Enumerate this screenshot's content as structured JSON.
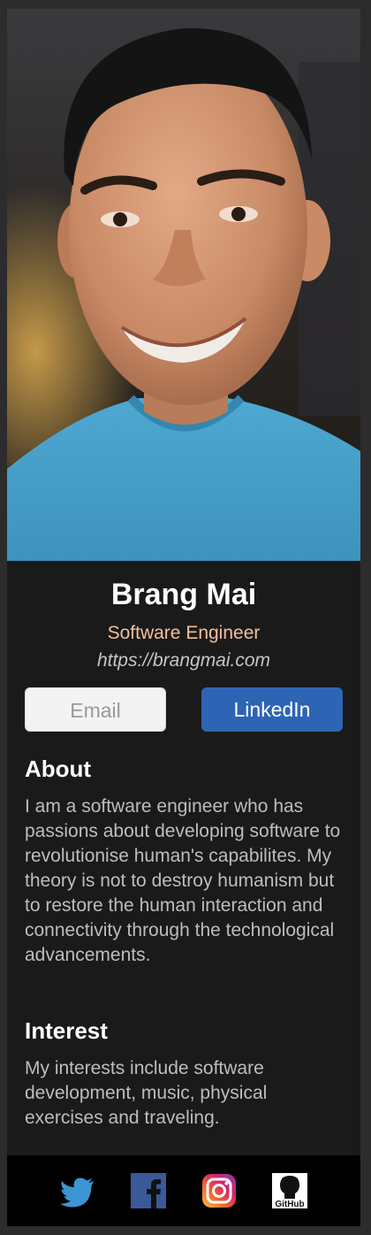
{
  "profile": {
    "name": "Brang Mai",
    "title": "Software Engineer",
    "website": "https://brangmai.com"
  },
  "buttons": {
    "email_label": "Email",
    "linkedin_label": "LinkedIn"
  },
  "about": {
    "heading": "About",
    "text": "I am a software engineer who has passions about developing software to revolutionise human's capabilites. My theory is not to destroy humanism but to restore the human interaction and connectivity through the technological advancements."
  },
  "interest": {
    "heading": "Interest",
    "text": "My interests include software development, music, physical exercises and traveling."
  },
  "footer": {
    "icons": [
      "twitter-icon",
      "facebook-icon",
      "instagram-icon",
      "github-icon"
    ],
    "github_text": "GitHub"
  },
  "colors": {
    "card_background": "#1a1a1b",
    "page_background": "#2c2c2c",
    "title_accent": "#f3bf99",
    "linkedin_blue": "#2e64b4",
    "footer_background": "#000000"
  }
}
